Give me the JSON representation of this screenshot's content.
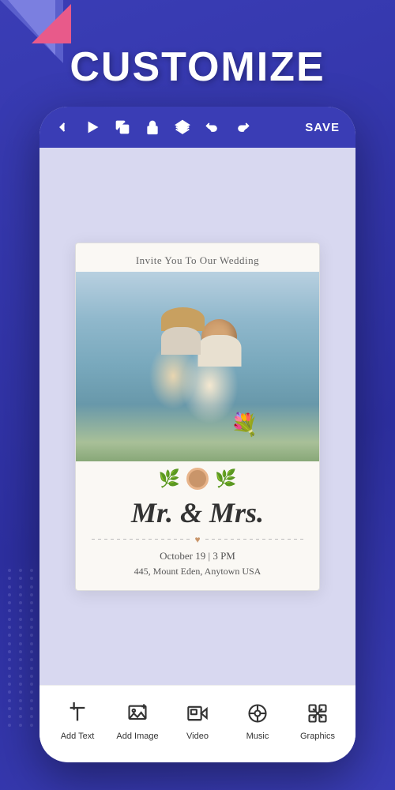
{
  "app": {
    "title": "CUSTOMIZE"
  },
  "toolbar": {
    "back_label": "‹",
    "save_label": "SAVE",
    "icons": [
      "back",
      "play",
      "copy",
      "lock",
      "layers",
      "undo",
      "redo"
    ]
  },
  "card": {
    "header": "Invite You To Our Wedding",
    "names": "Mr. & Mrs.",
    "date": "October 19 | 3 PM",
    "location": "445, Mount Eden, Anytown USA"
  },
  "bottom_toolbar": {
    "items": [
      {
        "id": "add-text",
        "label": "Add Text",
        "icon": "T"
      },
      {
        "id": "add-image",
        "label": "Add Image",
        "icon": "image"
      },
      {
        "id": "video",
        "label": "Video",
        "icon": "video"
      },
      {
        "id": "music",
        "label": "Music",
        "icon": "music"
      },
      {
        "id": "graphics",
        "label": "Graphics",
        "icon": "graphics"
      }
    ]
  },
  "colors": {
    "primary": "#3a3db5",
    "accent": "#c9956a",
    "card_bg": "#faf8f4"
  }
}
